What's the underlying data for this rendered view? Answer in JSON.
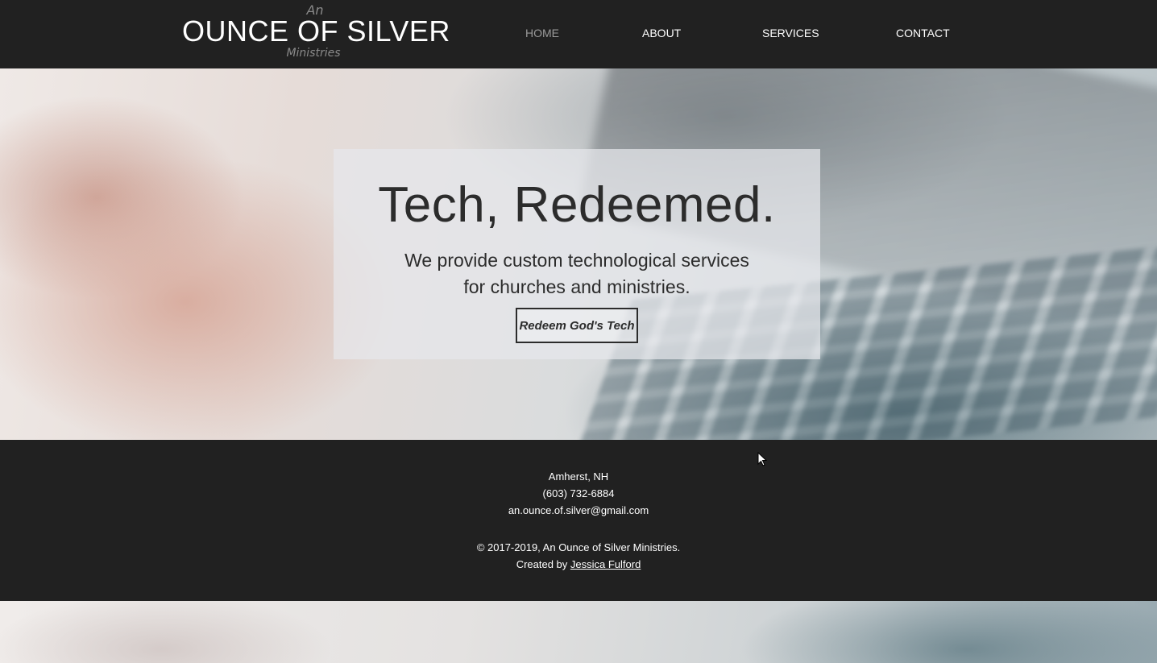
{
  "header": {
    "logo": {
      "top": "An",
      "main": "OUNCE OF SILVER",
      "bottom": "Ministries"
    },
    "nav": [
      {
        "label": "HOME",
        "active": true
      },
      {
        "label": "ABOUT",
        "active": false
      },
      {
        "label": "SERVICES",
        "active": false
      },
      {
        "label": "CONTACT",
        "active": false
      }
    ]
  },
  "hero": {
    "title": "Tech, Redeemed.",
    "subtitle_line1": "We provide custom technological services",
    "subtitle_line2": "for churches and ministries.",
    "button_label": "Redeem God's Tech"
  },
  "footer": {
    "location": "Amherst, NH",
    "phone": "(603) 732-6884",
    "email": "an.ounce.of.silver@gmail.com",
    "copyright": "© 2017-2019, An Ounce of Silver Ministries.",
    "created_by_prefix": "Created by ",
    "created_by_name": "Jessica Fulford"
  },
  "colors": {
    "header_bg": "#212121",
    "footer_bg": "#212121",
    "nav_active": "#9a9a9a",
    "nav_text": "#ffffff",
    "hero_text": "#2c2c2c"
  },
  "icons": {
    "cursor": "mouse-pointer-icon"
  }
}
